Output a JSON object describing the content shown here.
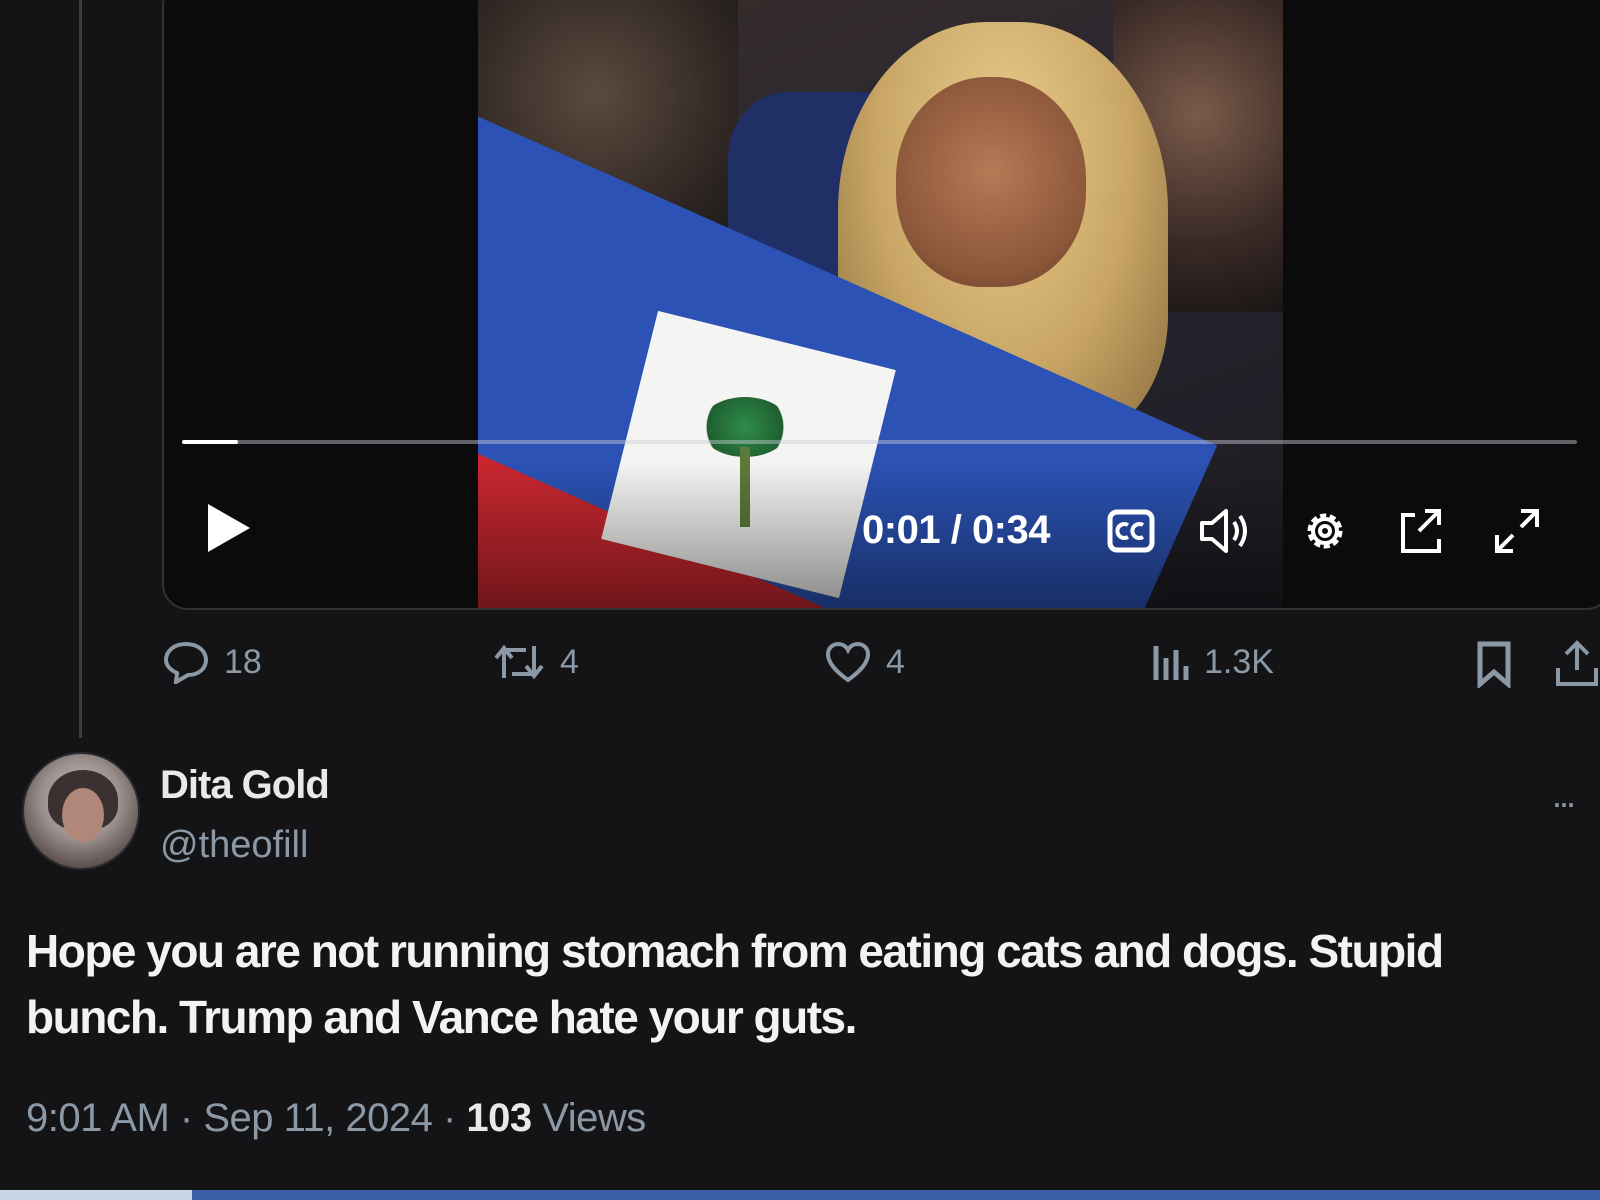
{
  "video": {
    "current_time": "0:01",
    "separator": "/",
    "duration": "0:34",
    "progress_fraction": 0.04
  },
  "actions": {
    "replies": "18",
    "reposts": "4",
    "likes": "4",
    "views": "1.3K"
  },
  "reply": {
    "display_name": "Dita Gold",
    "handle": "@theofill",
    "more_label": "...",
    "text": "Hope you are not running stomach from eating cats and dogs. Stupid bunch. Trump and Vance hate your guts.",
    "time": "9:01 AM",
    "date": "Sep 11, 2024",
    "view_count": "103",
    "views_label": "Views"
  },
  "icons": [
    "play-icon",
    "closed-captions-icon",
    "volume-icon",
    "settings-gear-icon",
    "pip-icon",
    "fullscreen-icon",
    "reply-icon",
    "repost-icon",
    "like-heart-icon",
    "views-chart-icon",
    "bookmark-icon",
    "share-icon",
    "more-icon"
  ]
}
